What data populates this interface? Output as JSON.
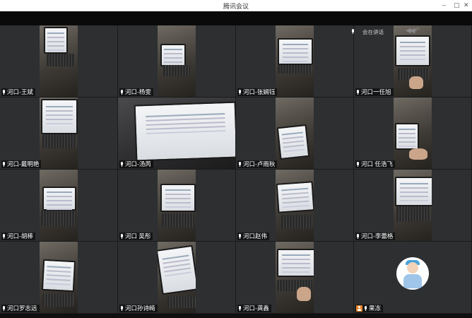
{
  "window": {
    "title": "腾讯会议",
    "minimize": "–",
    "maximize": "▢",
    "close": "✕"
  },
  "overlay": {
    "speaking_label": "会在讲话",
    "nav": "◀◀ ↶"
  },
  "participants": [
    {
      "name": "河口-王斌",
      "cam": "photo"
    },
    {
      "name": "河口-杨雯",
      "cam": "photo"
    },
    {
      "name": "河口-张娴钰",
      "cam": "photo"
    },
    {
      "name": "河口一任旭",
      "cam": "photo"
    },
    {
      "name": "河口-戴明艳",
      "cam": "photo"
    },
    {
      "name": "河口-汤芮",
      "cam": "wide"
    },
    {
      "name": "河口-卢雨秋",
      "cam": "photo"
    },
    {
      "name": "河口 任浩飞",
      "cam": "photo"
    },
    {
      "name": "河口-胡棒",
      "cam": "photo"
    },
    {
      "name": "河口 吴彤",
      "cam": "photo"
    },
    {
      "name": "河口赵伟",
      "cam": "photo"
    },
    {
      "name": "河口-李蕾格",
      "cam": "photo"
    },
    {
      "name": "河口罗志远",
      "cam": "photo"
    },
    {
      "name": "河口孙诗畸",
      "cam": "photo"
    },
    {
      "name": "河口-龚鑫",
      "cam": "photo"
    },
    {
      "name": "果冻",
      "cam": "avatar"
    }
  ]
}
